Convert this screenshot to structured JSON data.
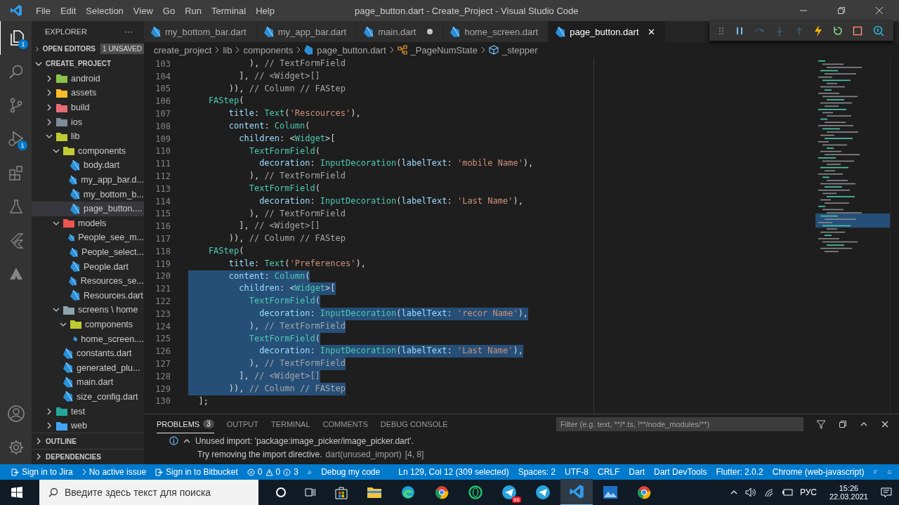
{
  "window": {
    "title": "page_button.dart - Create_Project - Visual Studio Code"
  },
  "menu": [
    "File",
    "Edit",
    "Selection",
    "View",
    "Go",
    "Run",
    "Terminal",
    "Help"
  ],
  "activity_bar": {
    "explorer_badge": "1",
    "debug_badge": "1"
  },
  "sidebar": {
    "title": "EXPLORER",
    "more": "···",
    "open_editors": "OPEN EDITORS",
    "unsaved": "1 UNSAVED",
    "project": "CREATE_PROJECT",
    "tree": [
      {
        "label": "android",
        "kind": "folder",
        "color": "#8bc34a",
        "expanded": false,
        "selected": false
      },
      {
        "label": "assets",
        "kind": "folder",
        "color": "#f9bd2b",
        "expanded": false,
        "selected": false
      },
      {
        "label": "build",
        "kind": "folder",
        "color": "#e56b75",
        "expanded": false,
        "selected": false
      },
      {
        "label": "ios",
        "kind": "folder",
        "color": "#7d8b9b",
        "expanded": false,
        "selected": false
      },
      {
        "label": "lib",
        "kind": "folder",
        "color": "#c0ca33",
        "expanded": true,
        "selected": false,
        "children": [
          {
            "label": "components",
            "kind": "folder",
            "color": "#c0ca33",
            "expanded": true,
            "selected": false,
            "children": [
              {
                "label": "body.dart",
                "kind": "file",
                "selected": false
              },
              {
                "label": "my_app_bar.d...",
                "kind": "file",
                "selected": false
              },
              {
                "label": "my_bottom_b...",
                "kind": "file",
                "selected": false
              },
              {
                "label": "page_button....",
                "kind": "file",
                "selected": true
              }
            ]
          },
          {
            "label": "models",
            "kind": "folder",
            "color": "#ef5350",
            "expanded": true,
            "selected": false,
            "children": [
              {
                "label": "People_see_m...",
                "kind": "file",
                "selected": false
              },
              {
                "label": "People_select...",
                "kind": "file",
                "selected": false
              },
              {
                "label": "People.dart",
                "kind": "file",
                "selected": false
              },
              {
                "label": "Resources_se...",
                "kind": "file",
                "selected": false
              },
              {
                "label": "Resources.dart",
                "kind": "file",
                "selected": false
              }
            ]
          },
          {
            "label": "screens \\ home",
            "kind": "folder",
            "color": "#90a4ae",
            "expanded": true,
            "selected": false,
            "children": [
              {
                "label": "components",
                "kind": "folder",
                "color": "#c0ca33",
                "expanded": true,
                "selected": false,
                "children": [
                  {
                    "label": "home_screen....",
                    "kind": "file",
                    "selected": false
                  }
                ]
              }
            ]
          },
          {
            "label": "constants.dart",
            "kind": "file",
            "selected": false
          },
          {
            "label": "generated_plu...",
            "kind": "file",
            "selected": false
          },
          {
            "label": "main.dart",
            "kind": "file",
            "selected": false
          },
          {
            "label": "size_config.dart",
            "kind": "file",
            "selected": false
          }
        ]
      },
      {
        "label": "test",
        "kind": "folder",
        "color": "#26a69a",
        "expanded": false,
        "selected": false
      },
      {
        "label": "web",
        "kind": "folder",
        "color": "#42a5f5",
        "expanded": false,
        "selected": false
      }
    ],
    "sections": [
      "OUTLINE",
      "DEPENDENCIES"
    ]
  },
  "tabs": [
    {
      "label": "my_bottom_bar.dart",
      "selected": false,
      "modified": false
    },
    {
      "label": "my_app_bar.dart",
      "selected": false,
      "modified": false
    },
    {
      "label": "main.dart",
      "selected": false,
      "modified": true
    },
    {
      "label": "home_screen.dart",
      "selected": false,
      "modified": false
    },
    {
      "label": "page_button.dart",
      "selected": true,
      "modified": false
    }
  ],
  "close_glyph": "✕",
  "breadcrumb": [
    {
      "label": "create_project",
      "kind": "plain"
    },
    {
      "label": "lib",
      "kind": "plain"
    },
    {
      "label": "components",
      "kind": "plain"
    },
    {
      "label": "page_button.dart",
      "kind": "file"
    },
    {
      "label": "_PageNumState",
      "kind": "class"
    },
    {
      "label": "_stepper",
      "kind": "field"
    }
  ],
  "code": [
    {
      "number": "103",
      "selected": false,
      "tokens": [
        {
          "kind": "p",
          "text": "            ), "
        },
        {
          "kind": "c",
          "text": "// TextFormField"
        }
      ]
    },
    {
      "number": "104",
      "selected": false,
      "tokens": [
        {
          "kind": "p",
          "text": "          ], "
        },
        {
          "kind": "c",
          "text": "// <Widget>[]"
        }
      ]
    },
    {
      "number": "105",
      "selected": false,
      "tokens": [
        {
          "kind": "p",
          "text": "        )), "
        },
        {
          "kind": "c",
          "text": "// Column // FAStep"
        }
      ]
    },
    {
      "number": "106",
      "selected": false,
      "tokens": [
        {
          "kind": "t",
          "text": "    FAStep"
        },
        {
          "kind": "p",
          "text": "("
        }
      ]
    },
    {
      "number": "107",
      "selected": false,
      "tokens": [
        {
          "kind": "v",
          "text": "        title"
        },
        {
          "kind": "p",
          "text": ": "
        },
        {
          "kind": "t",
          "text": "Text"
        },
        {
          "kind": "p",
          "text": "("
        },
        {
          "kind": "s",
          "text": "'Rescources'"
        },
        {
          "kind": "p",
          "text": "),"
        }
      ]
    },
    {
      "number": "108",
      "selected": false,
      "tokens": [
        {
          "kind": "v",
          "text": "        content"
        },
        {
          "kind": "p",
          "text": ": "
        },
        {
          "kind": "t",
          "text": "Column"
        },
        {
          "kind": "p",
          "text": "("
        }
      ]
    },
    {
      "number": "109",
      "selected": false,
      "tokens": [
        {
          "kind": "v",
          "text": "          children"
        },
        {
          "kind": "p",
          "text": ": <"
        },
        {
          "kind": "t",
          "text": "Widget"
        },
        {
          "kind": "p",
          "text": ">["
        }
      ]
    },
    {
      "number": "110",
      "selected": false,
      "tokens": [
        {
          "kind": "t",
          "text": "            TextFormField"
        },
        {
          "kind": "p",
          "text": "("
        }
      ]
    },
    {
      "number": "111",
      "selected": false,
      "tokens": [
        {
          "kind": "v",
          "text": "              decoration"
        },
        {
          "kind": "p",
          "text": ": "
        },
        {
          "kind": "t",
          "text": "InputDecoration"
        },
        {
          "kind": "p",
          "text": "("
        },
        {
          "kind": "v",
          "text": "labelText"
        },
        {
          "kind": "p",
          "text": ": "
        },
        {
          "kind": "s",
          "text": "'mobile Name'"
        },
        {
          "kind": "p",
          "text": "),"
        }
      ]
    },
    {
      "number": "112",
      "selected": false,
      "tokens": [
        {
          "kind": "p",
          "text": "            ), "
        },
        {
          "kind": "c",
          "text": "// TextFormField"
        }
      ]
    },
    {
      "number": "113",
      "selected": false,
      "tokens": [
        {
          "kind": "t",
          "text": "            TextFormField"
        },
        {
          "kind": "p",
          "text": "("
        }
      ]
    },
    {
      "number": "114",
      "selected": false,
      "tokens": [
        {
          "kind": "v",
          "text": "              decoration"
        },
        {
          "kind": "p",
          "text": ": "
        },
        {
          "kind": "t",
          "text": "InputDecoration"
        },
        {
          "kind": "p",
          "text": "("
        },
        {
          "kind": "v",
          "text": "labelText"
        },
        {
          "kind": "p",
          "text": ": "
        },
        {
          "kind": "s",
          "text": "'Last Name'"
        },
        {
          "kind": "p",
          "text": "),"
        }
      ]
    },
    {
      "number": "115",
      "selected": false,
      "tokens": [
        {
          "kind": "p",
          "text": "            ), "
        },
        {
          "kind": "c",
          "text": "// TextFormField"
        }
      ]
    },
    {
      "number": "116",
      "selected": false,
      "tokens": [
        {
          "kind": "p",
          "text": "          ], "
        },
        {
          "kind": "c",
          "text": "// <Widget>[]"
        }
      ]
    },
    {
      "number": "117",
      "selected": false,
      "tokens": [
        {
          "kind": "p",
          "text": "        )), "
        },
        {
          "kind": "c",
          "text": "// Column // FAStep"
        }
      ]
    },
    {
      "number": "118",
      "selected": false,
      "tokens": [
        {
          "kind": "t",
          "text": "    FAStep"
        },
        {
          "kind": "p",
          "text": "("
        }
      ]
    },
    {
      "number": "119",
      "selected": false,
      "tokens": [
        {
          "kind": "v",
          "text": "        title"
        },
        {
          "kind": "p",
          "text": ": "
        },
        {
          "kind": "t",
          "text": "Text"
        },
        {
          "kind": "p",
          "text": "("
        },
        {
          "kind": "s",
          "text": "'Preferences'"
        },
        {
          "kind": "p",
          "text": "),"
        }
      ]
    },
    {
      "number": "120",
      "selected": true,
      "tokens": [
        {
          "kind": "v",
          "text": "        content"
        },
        {
          "kind": "p",
          "text": ": "
        },
        {
          "kind": "t",
          "text": "Column"
        },
        {
          "kind": "p",
          "text": "("
        }
      ]
    },
    {
      "number": "121",
      "selected": true,
      "tokens": [
        {
          "kind": "v",
          "text": "          children"
        },
        {
          "kind": "p",
          "text": ": <"
        },
        {
          "kind": "t",
          "text": "Widget"
        },
        {
          "kind": "p",
          "text": ">["
        }
      ]
    },
    {
      "number": "122",
      "selected": true,
      "tokens": [
        {
          "kind": "t",
          "text": "            TextFormField"
        },
        {
          "kind": "p",
          "text": "("
        }
      ]
    },
    {
      "number": "123",
      "selected": true,
      "tokens": [
        {
          "kind": "v",
          "text": "              decoration"
        },
        {
          "kind": "p",
          "text": ": "
        },
        {
          "kind": "t",
          "text": "InputDecoration"
        },
        {
          "kind": "p",
          "text": "("
        },
        {
          "kind": "v",
          "text": "labelText"
        },
        {
          "kind": "p",
          "text": ": "
        },
        {
          "kind": "s",
          "text": "'recor Name'"
        },
        {
          "kind": "p",
          "text": "),"
        }
      ]
    },
    {
      "number": "124",
      "selected": true,
      "tokens": [
        {
          "kind": "p",
          "text": "            ), "
        },
        {
          "kind": "c",
          "text": "// TextFormField"
        }
      ]
    },
    {
      "number": "125",
      "selected": true,
      "tokens": [
        {
          "kind": "t",
          "text": "            TextFormField"
        },
        {
          "kind": "p",
          "text": "("
        }
      ]
    },
    {
      "number": "126",
      "selected": true,
      "tokens": [
        {
          "kind": "v",
          "text": "              decoration"
        },
        {
          "kind": "p",
          "text": ": "
        },
        {
          "kind": "t",
          "text": "InputDecoration"
        },
        {
          "kind": "p",
          "text": "("
        },
        {
          "kind": "v",
          "text": "labelText"
        },
        {
          "kind": "p",
          "text": ": "
        },
        {
          "kind": "s",
          "text": "'Last Name'"
        },
        {
          "kind": "p",
          "text": "),"
        }
      ]
    },
    {
      "number": "127",
      "selected": true,
      "tokens": [
        {
          "kind": "p",
          "text": "            ), "
        },
        {
          "kind": "c",
          "text": "// TextFormField"
        }
      ]
    },
    {
      "number": "128",
      "selected": true,
      "tokens": [
        {
          "kind": "p",
          "text": "          ], "
        },
        {
          "kind": "c",
          "text": "// <Widget>[]"
        }
      ]
    },
    {
      "number": "129",
      "selected": true,
      "tokens": [
        {
          "kind": "p",
          "text": "        )), "
        },
        {
          "kind": "c",
          "text": "// Column // FAStep"
        }
      ]
    },
    {
      "number": "130",
      "selected": false,
      "tokens": [
        {
          "kind": "p",
          "text": "  ];"
        }
      ]
    }
  ],
  "panel": {
    "tabs": [
      {
        "label": "PROBLEMS",
        "selected": true,
        "count": "3"
      },
      {
        "label": "OUTPUT",
        "selected": false
      },
      {
        "label": "TERMINAL",
        "selected": false
      },
      {
        "label": "COMMENTS",
        "selected": false
      },
      {
        "label": "DEBUG CONSOLE",
        "selected": false
      }
    ],
    "filter": {
      "placeholder": "Filter (e.g. text, **/*.ts, !**/node_modules/**)"
    },
    "problem": {
      "message": "Unused import: 'package:image_picker/image_picker.dart'.",
      "hint": "Try removing the import directive.",
      "source": "dart(unused_import)",
      "position": "[4, 8]"
    }
  },
  "status_bar": {
    "left": [
      {
        "label": "Sign in to Jira",
        "kind": "jira"
      },
      {
        "label": "No active issue",
        "kind": "chevron"
      },
      {
        "label": "Sign in to Bitbucket",
        "kind": "jira"
      }
    ],
    "errors": "0",
    "warnings": "0",
    "infos": "3",
    "debug": "Debug my code",
    "right": [
      "Ln 129, Col 12 (309 selected)",
      "Spaces: 2",
      "UTF-8",
      "CRLF",
      "Dart",
      "Dart DevTools",
      "Flutter: 2.0.2",
      "Chrome (web-javascript)"
    ]
  },
  "taskbar": {
    "search": {
      "placeholder": "Введите здесь текст для поиска"
    },
    "telegram_badge": "86",
    "language": "РУС",
    "time": "15:26",
    "date": "22.03.2021"
  }
}
